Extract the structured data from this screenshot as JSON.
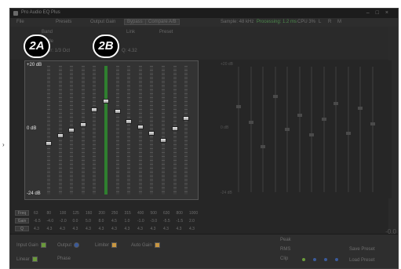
{
  "window": {
    "title": "Pro Audio EQ Plus"
  },
  "toolbar": {
    "items": [
      {
        "label": "File"
      },
      {
        "label": "Presets"
      },
      {
        "label": "Output Gain"
      },
      {
        "label": "Bypass"
      },
      {
        "label": "Compare A/B"
      }
    ],
    "right": [
      {
        "label": "Sample: 48 kHz"
      },
      {
        "label": "Processing: 1.2 ms"
      },
      {
        "label": "CPU 3%"
      },
      {
        "label": "L"
      },
      {
        "label": "R"
      },
      {
        "label": "M"
      }
    ]
  },
  "sub": {
    "left1": "Band",
    "left2": "Mode",
    "left3": "Filter: 1/3 Oct",
    "mid1": "Q: 4.32",
    "mid2": "Link",
    "mid3": "Preset"
  },
  "badges": {
    "a": "2A",
    "b": "2B"
  },
  "eq_a": {
    "labels": {
      "top": "+20 dB",
      "mid": "0 dB",
      "bottom": "-24 dB"
    },
    "sliders": [
      {
        "gain": -6.5
      },
      {
        "gain": -4.0
      },
      {
        "gain": -2.0
      },
      {
        "gain": 0.0
      },
      {
        "gain": 5.0
      },
      {
        "gain": 8.0,
        "selected": true
      },
      {
        "gain": 4.5
      },
      {
        "gain": 1.0
      },
      {
        "gain": -1.0
      },
      {
        "gain": -3.0
      },
      {
        "gain": -5.5
      },
      {
        "gain": -1.5
      },
      {
        "gain": 2.0
      }
    ]
  },
  "eq_b": {
    "labels": {
      "top": "+20 dB",
      "mid": "0 dB",
      "bottom": "-24 dB"
    },
    "sliders": [
      {
        "gain": 6.0
      },
      {
        "gain": 0.5
      },
      {
        "gain": -8.0
      },
      {
        "gain": 9.5
      },
      {
        "gain": -2.0
      },
      {
        "gain": 3.0
      },
      {
        "gain": -4.0
      },
      {
        "gain": 1.5
      },
      {
        "gain": 7.0
      },
      {
        "gain": -3.5
      },
      {
        "gain": 5.5
      },
      {
        "gain": 0.0
      }
    ]
  },
  "rows": {
    "buttons": [
      "Freq",
      "Gain",
      "Q"
    ],
    "freq": [
      "63",
      "80",
      "100",
      "125",
      "160",
      "200",
      "250",
      "315",
      "400",
      "500",
      "630",
      "800",
      "1000"
    ],
    "gain": [
      "-6.5",
      "-4.0",
      "-2.0",
      "0.0",
      "5.0",
      "8.0",
      "4.5",
      "1.0",
      "-1.0",
      "-3.0",
      "-5.5",
      "-1.5",
      "2.0"
    ],
    "q": [
      "4.3",
      "4.3",
      "4.3",
      "4.3",
      "4.3",
      "4.3",
      "4.3",
      "4.3",
      "4.3",
      "4.3",
      "4.3",
      "4.3",
      "4.3"
    ]
  },
  "bottom": {
    "c1": "Input Gain",
    "c2": "Output",
    "c3": "Limiter",
    "c4": "Auto Gain",
    "c5": "Linear",
    "c6": "Phase",
    "meters": [
      "Peak",
      "RMS",
      "Clip"
    ],
    "right1": "Save Preset",
    "right2": "Load Preset",
    "readout": "-0.0"
  },
  "colors": {
    "accent": "#2f7f2f",
    "badge_bg": "#000000"
  }
}
